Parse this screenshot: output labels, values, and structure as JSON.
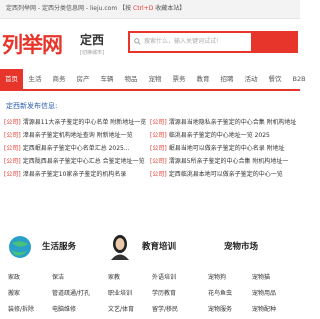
{
  "topbar": {
    "text": "定西列举网 - 定西分类信息网 - lieju.com 【按 ",
    "kbd": "Ctrl+D",
    "suffix": " 收藏本站】"
  },
  "header": {
    "logo": "列举网",
    "city": "定西",
    "city_sub": "[切换城市]",
    "search_placeholder": "搜索什么，输入关键词试试!"
  },
  "nav": [
    "首页",
    "生活",
    "商务",
    "房产",
    "车辆",
    "物品",
    "宠物",
    "票务",
    "教育",
    "招聘",
    "活动",
    "餐饮",
    "B2B"
  ],
  "section_title": "定西新发布信息:",
  "listings": {
    "left": [
      {
        "tag": "[公司]",
        "text": "渭源县11大亲子鉴定的中心名单 附新地址一览"
      },
      {
        "tag": "[公司]",
        "text": "漳县亲子鉴定机构地址查询 附新地址一览"
      },
      {
        "tag": "[公司]",
        "text": "定西岷县亲子鉴定中心名单汇总 2025..."
      },
      {
        "tag": "[公司]",
        "text": "定西陇西县亲子鉴定中心汇总 合鉴定地址一览"
      },
      {
        "tag": "[公司]",
        "text": "漳县亲子鉴定10家亲子鉴定的机构名录"
      }
    ],
    "right": [
      {
        "tag": "[公司]",
        "text": "渭源县当地隐私亲子鉴定的中心合集 附机构地址"
      },
      {
        "tag": "[公司]",
        "text": "临洮县亲子鉴定的中心地址一览 2025"
      },
      {
        "tag": "[公司]",
        "text": "岷县当地可以做亲子鉴定的中心名录 附地址"
      },
      {
        "tag": "[公司]",
        "text": "渭源县5所亲子鉴定的中心合集 附机构地址一"
      },
      {
        "tag": "[公司]",
        "text": "定西临洮县本地可以做亲子鉴定的中心一览"
      }
    ]
  },
  "categories": [
    {
      "title": "生活服务",
      "links": [
        "家政",
        "保洁",
        "搬家",
        "管道疏通/打孔",
        "装修/拆除",
        "电脑维修"
      ]
    },
    {
      "title": "教育培训",
      "links": [
        "家教",
        "外语培训",
        "职业培训",
        "学历教育",
        "文艺/体育",
        "留学/移民"
      ]
    },
    {
      "title": "宠物市场",
      "links": [
        "宠物狗",
        "宠物猫",
        "花鸟鱼虫",
        "宠物用品",
        "宠物服务",
        "宠物配种"
      ]
    }
  ],
  "colors": {
    "brand": "#e8352b",
    "link_blue": "#2a5db0"
  }
}
